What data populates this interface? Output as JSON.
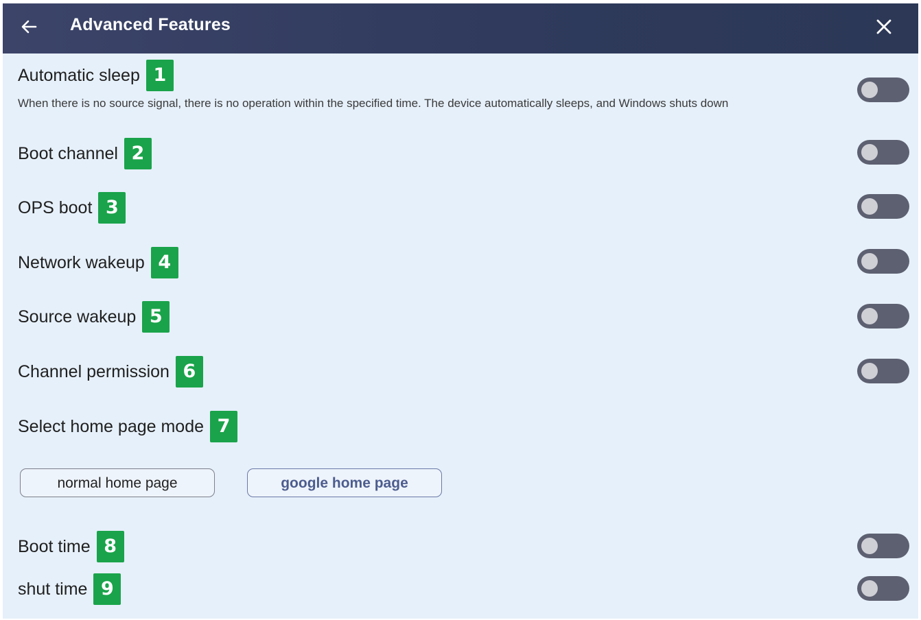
{
  "window": {
    "title": "Advanced Features",
    "back_icon": "arrow-left-icon",
    "close_icon": "close-icon"
  },
  "settings": [
    {
      "label": "Automatic sleep",
      "badge": "1",
      "description": "When there is no source signal, there is no operation within the specified time. The device automatically sleeps, and Windows shuts down",
      "enabled": false
    },
    {
      "label": "Boot channel",
      "badge": "2",
      "enabled": false
    },
    {
      "label": "OPS boot",
      "badge": "3",
      "enabled": false
    },
    {
      "label": "Network wakeup",
      "badge": "4",
      "enabled": false
    },
    {
      "label": "Source wakeup",
      "badge": "5",
      "enabled": false
    },
    {
      "label": "Channel permission",
      "badge": "6",
      "enabled": false
    }
  ],
  "home_mode": {
    "label": "Select home page mode",
    "badge": "7",
    "options": [
      "normal home page",
      "google home page"
    ],
    "selected": "google home page"
  },
  "schedule": [
    {
      "label": "Boot time",
      "badge": "8",
      "enabled": false
    },
    {
      "label": "shut time",
      "badge": "9",
      "enabled": false
    }
  ],
  "colors": {
    "titlebar": "#2f3a5c",
    "background": "#e6f0fa",
    "badge": "#1aa34a",
    "toggle_off": "#5d6070"
  }
}
